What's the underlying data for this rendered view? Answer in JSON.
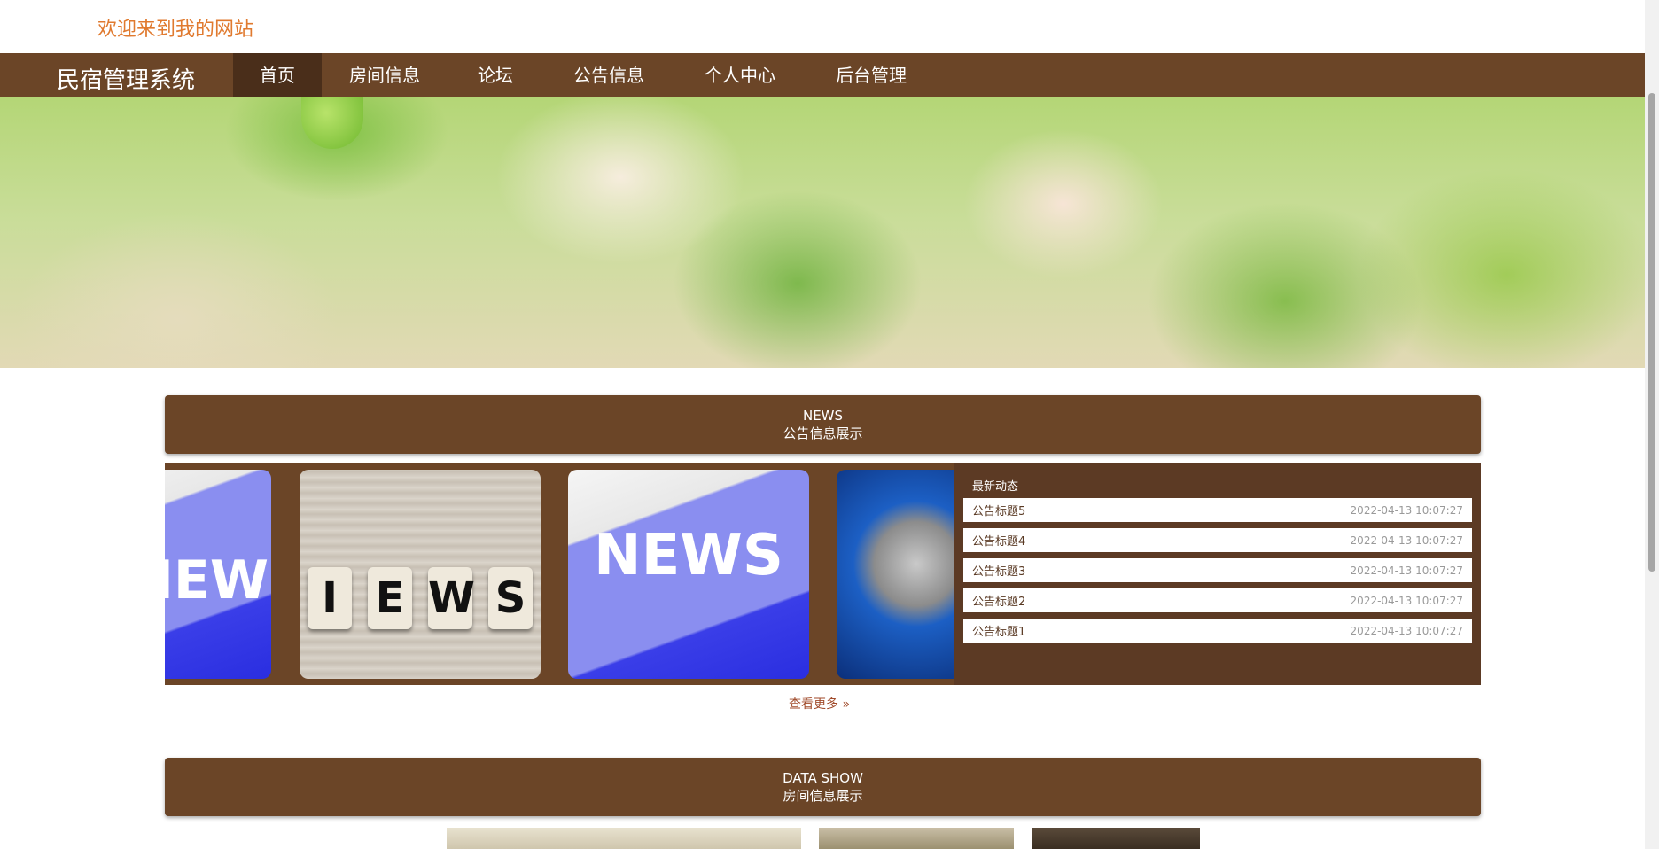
{
  "header": {
    "welcome": "欢迎来到我的网站"
  },
  "nav": {
    "brand": "民宿管理系统",
    "items": [
      {
        "label": "首页",
        "active": true
      },
      {
        "label": "房间信息",
        "active": false
      },
      {
        "label": "论坛",
        "active": false
      },
      {
        "label": "公告信息",
        "active": false
      },
      {
        "label": "个人中心",
        "active": false
      },
      {
        "label": "后台管理",
        "active": false
      }
    ]
  },
  "banner": {
    "slides": 3,
    "active_slide": 2
  },
  "news_section": {
    "title_en": "NEWS",
    "title_cn": "公告信息展示",
    "images": [
      "NEWS",
      "NEWS",
      "NEWS"
    ],
    "list_title": "最新动态",
    "items": [
      {
        "title": "公告标题5",
        "date": "2022-04-13 10:07:27"
      },
      {
        "title": "公告标题4",
        "date": "2022-04-13 10:07:27"
      },
      {
        "title": "公告标题3",
        "date": "2022-04-13 10:07:27"
      },
      {
        "title": "公告标题2",
        "date": "2022-04-13 10:07:27"
      },
      {
        "title": "公告标题1",
        "date": "2022-04-13 10:07:27"
      }
    ],
    "more": "查看更多 »"
  },
  "data_section": {
    "title_en": "DATA SHOW",
    "title_cn": "房间信息展示"
  },
  "colors": {
    "brand": "#6b4527",
    "brand_dark": "#4a2e1a",
    "welcome": "#e07a2f"
  }
}
